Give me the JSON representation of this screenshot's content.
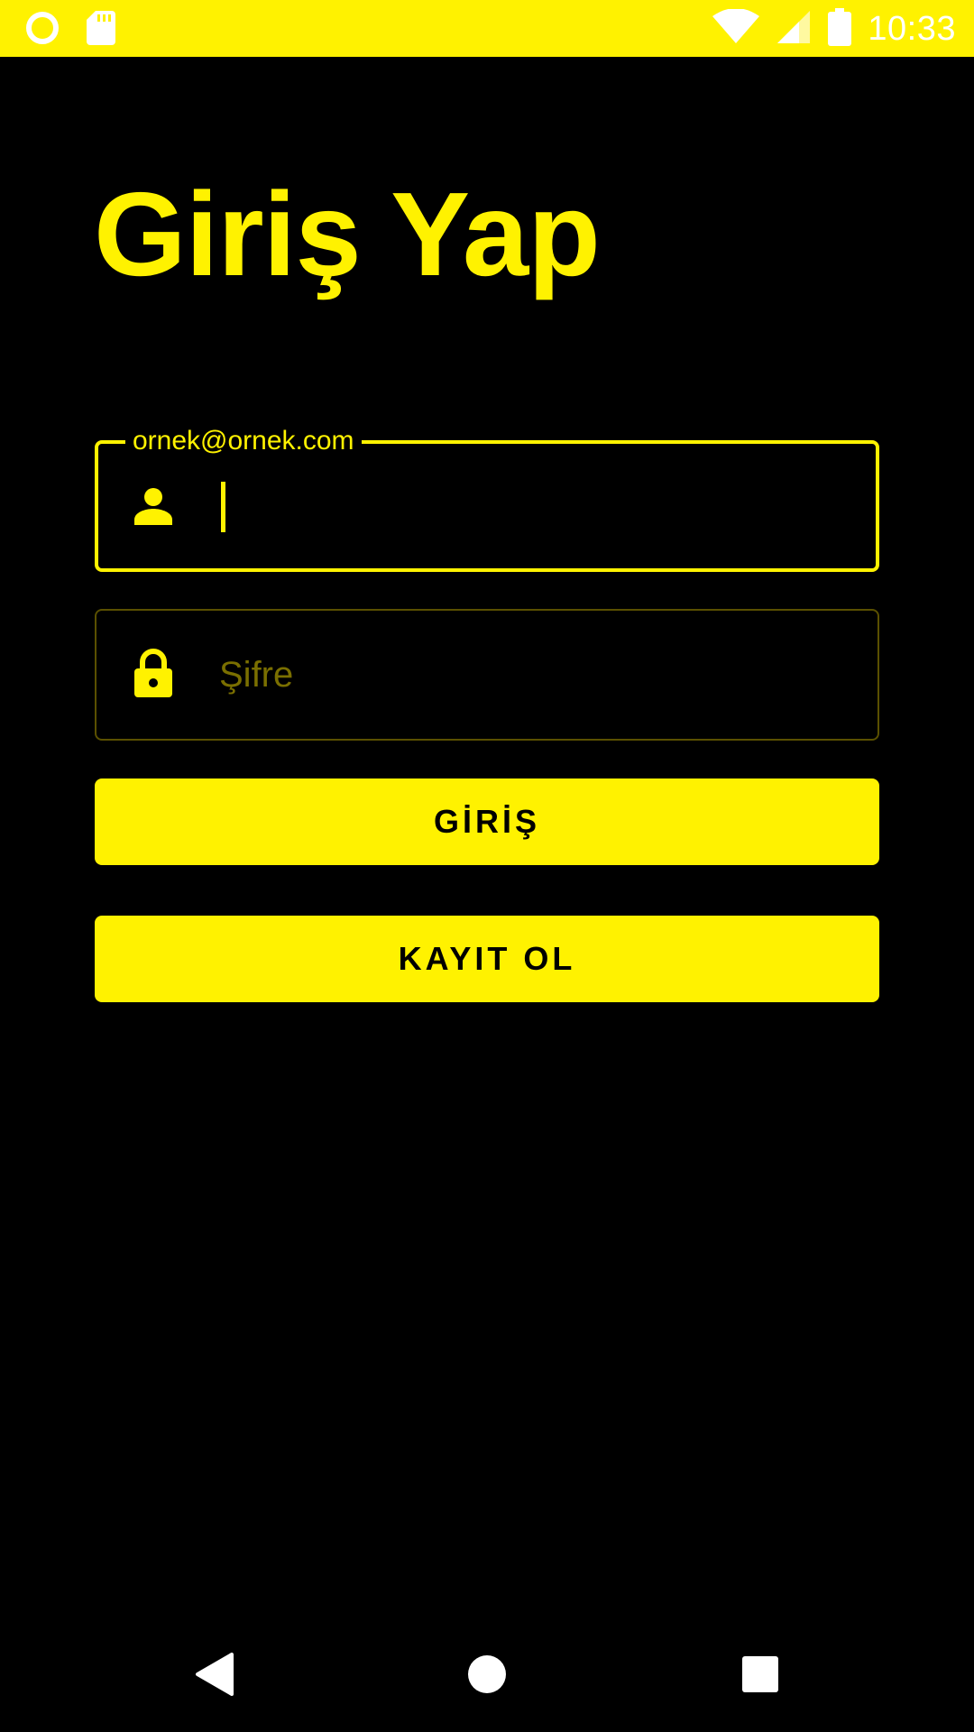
{
  "status_bar": {
    "time": "10:33",
    "icons": [
      "circle-notification-icon",
      "sd-card-icon",
      "wifi-icon",
      "cell-signal-icon",
      "battery-icon"
    ],
    "background": "#FFF200"
  },
  "login": {
    "title": "Giriş Yap",
    "email": {
      "label": "ornek@ornek.com",
      "value": "",
      "icon": "person-icon"
    },
    "password": {
      "placeholder": "Şifre",
      "value": "",
      "icon": "lock-icon"
    },
    "login_button": "GİRİŞ",
    "register_button": "KAYIT OL"
  },
  "nav_bar": {
    "icons": [
      "back-icon",
      "home-icon",
      "recents-icon"
    ]
  },
  "colors": {
    "accent": "#FFF200",
    "background": "#000000",
    "placeholder": "#7A6F00",
    "idle_border": "#5A5000"
  }
}
